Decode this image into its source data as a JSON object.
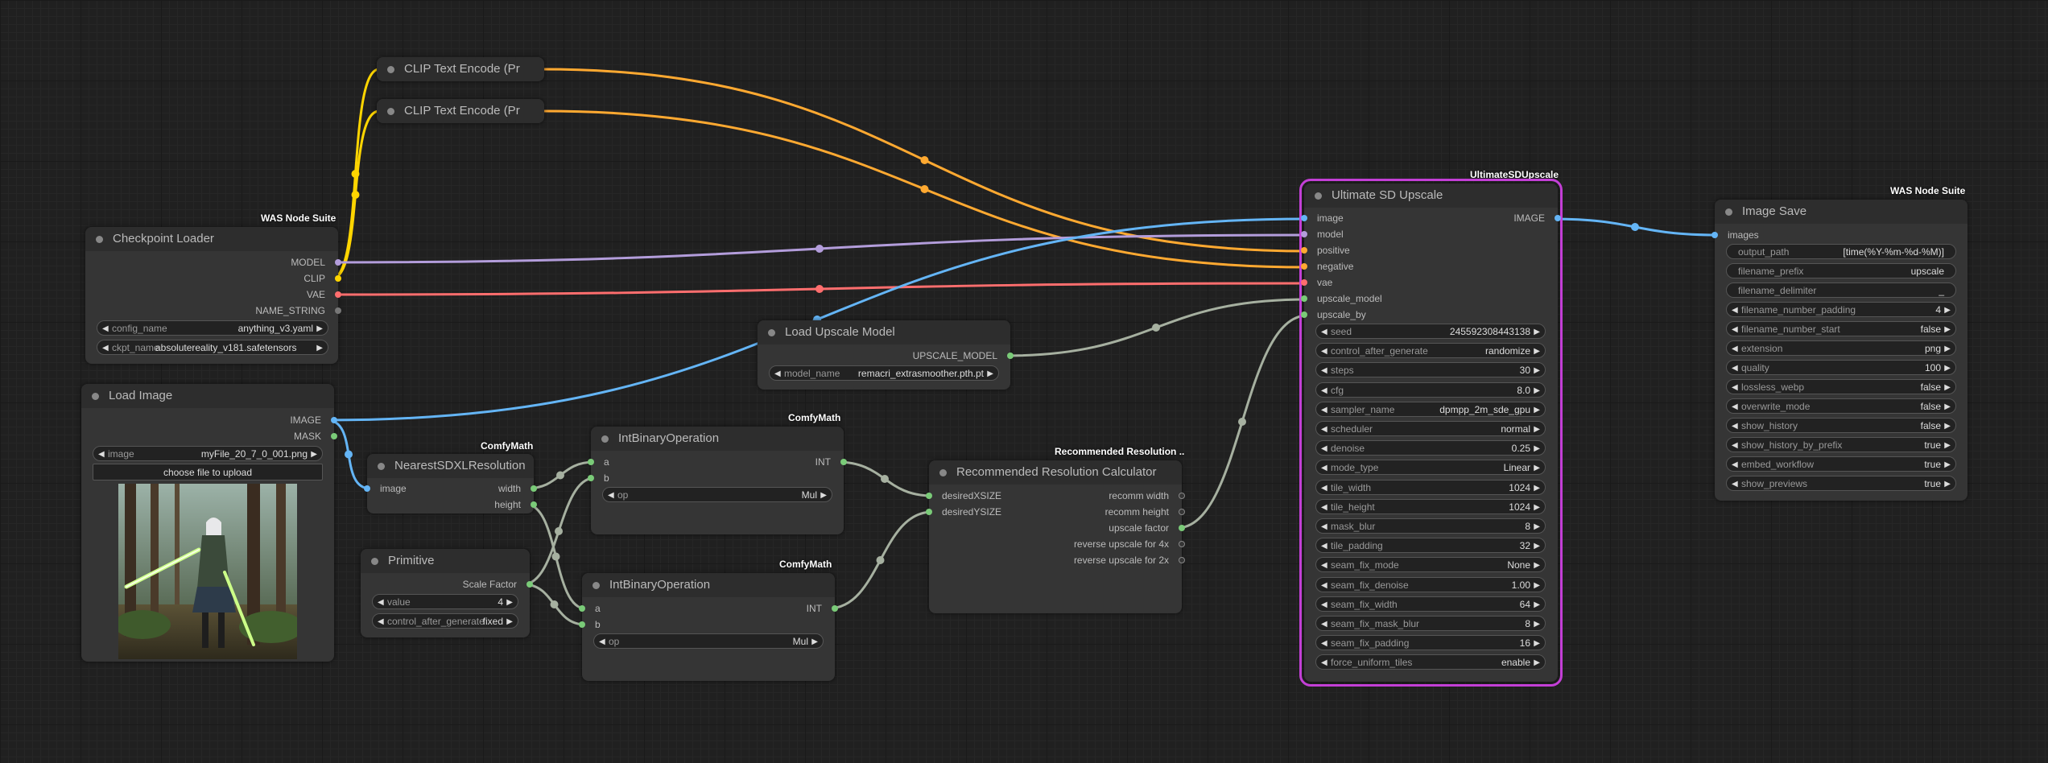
{
  "colors": {
    "model": "#b39ddb",
    "clip": "#ffd500",
    "vae": "#ff6e6e",
    "image": "#64b5f6",
    "conditioning": "#ffa931",
    "generic": "#7acb78",
    "upscale": "#a6b0a0",
    "selected": "#c33fd6"
  },
  "nodes": {
    "clip1": {
      "title": "CLIP Text Encode (Pr"
    },
    "clip2": {
      "title": "CLIP Text Encode (Pr"
    },
    "ckpt": {
      "badge": "WAS Node Suite",
      "title": "Checkpoint Loader",
      "outputs": [
        "MODEL",
        "CLIP",
        "VAE",
        "NAME_STRING"
      ],
      "config": {
        "label": "config_name",
        "value": "anything_v3.yaml"
      },
      "ckpt": {
        "label": "ckpt_name",
        "value": "absolutereality_v181.safetensors"
      }
    },
    "loadimg": {
      "title": "Load Image",
      "outputs": [
        "IMAGE",
        "MASK"
      ],
      "image": {
        "label": "image",
        "value": "myFile_20_7_0_001.png"
      },
      "upload": "choose file to upload"
    },
    "nearest": {
      "badge": "ComfyMath",
      "title": "NearestSDXLResolution",
      "inputs": [
        "image"
      ],
      "outputs": [
        "width",
        "height"
      ]
    },
    "primitive": {
      "title": "Primitive",
      "outputs": [
        "Scale Factor"
      ],
      "value": {
        "label": "value",
        "value": "4"
      },
      "cag": {
        "label": "control_after_generate",
        "value": "fixed"
      }
    },
    "ib1": {
      "badge": "ComfyMath",
      "title": "IntBinaryOperation",
      "inputs": [
        "a",
        "b"
      ],
      "outputs": [
        "INT"
      ],
      "op": {
        "label": "op",
        "value": "Mul"
      }
    },
    "ib2": {
      "badge": "ComfyMath",
      "title": "IntBinaryOperation",
      "inputs": [
        "a",
        "b"
      ],
      "outputs": [
        "INT"
      ],
      "op": {
        "label": "op",
        "value": "Mul"
      }
    },
    "upmodel": {
      "title": "Load Upscale Model",
      "outputs": [
        "UPSCALE_MODEL"
      ],
      "model": {
        "label": "model_name",
        "value": "remacri_extrasmoother.pth.pt"
      }
    },
    "recres": {
      "badge": "Recommended Resolution ..",
      "title": "Recommended Resolution Calculator",
      "inputs": [
        "desiredXSIZE",
        "desiredYSIZE"
      ],
      "outputs": [
        "recomm width",
        "recomm height",
        "upscale factor",
        "reverse upscale for 4x",
        "reverse upscale for 2x"
      ]
    },
    "usd": {
      "badge": "UltimateSDUpscale",
      "title": "Ultimate SD Upscale",
      "inputs": [
        "image",
        "model",
        "positive",
        "negative",
        "vae",
        "upscale_model",
        "upscale_by"
      ],
      "outputs": [
        "IMAGE"
      ],
      "widgets": [
        {
          "label": "seed",
          "value": "245592308443138"
        },
        {
          "label": "control_after_generate",
          "value": "randomize"
        },
        {
          "label": "steps",
          "value": "30"
        },
        {
          "label": "cfg",
          "value": "8.0"
        },
        {
          "label": "sampler_name",
          "value": "dpmpp_2m_sde_gpu"
        },
        {
          "label": "scheduler",
          "value": "normal"
        },
        {
          "label": "denoise",
          "value": "0.25"
        },
        {
          "label": "mode_type",
          "value": "Linear"
        },
        {
          "label": "tile_width",
          "value": "1024"
        },
        {
          "label": "tile_height",
          "value": "1024"
        },
        {
          "label": "mask_blur",
          "value": "8"
        },
        {
          "label": "tile_padding",
          "value": "32"
        },
        {
          "label": "seam_fix_mode",
          "value": "None"
        },
        {
          "label": "seam_fix_denoise",
          "value": "1.00"
        },
        {
          "label": "seam_fix_width",
          "value": "64"
        },
        {
          "label": "seam_fix_mask_blur",
          "value": "8"
        },
        {
          "label": "seam_fix_padding",
          "value": "16"
        },
        {
          "label": "force_uniform_tiles",
          "value": "enable"
        }
      ]
    },
    "save": {
      "badge": "WAS Node Suite",
      "title": "Image Save",
      "inputs": [
        "images"
      ],
      "texts": [
        {
          "label": "output_path",
          "value": "[time(%Y-%m-%d-%M)]"
        },
        {
          "label": "filename_prefix",
          "value": "upscale"
        },
        {
          "label": "filename_delimiter",
          "value": "_"
        }
      ],
      "widgets": [
        {
          "label": "filename_number_padding",
          "value": "4"
        },
        {
          "label": "filename_number_start",
          "value": "false"
        },
        {
          "label": "extension",
          "value": "png"
        },
        {
          "label": "quality",
          "value": "100"
        },
        {
          "label": "lossless_webp",
          "value": "false"
        },
        {
          "label": "overwrite_mode",
          "value": "false"
        },
        {
          "label": "show_history",
          "value": "false"
        },
        {
          "label": "show_history_by_prefix",
          "value": "true"
        },
        {
          "label": "embed_workflow",
          "value": "true"
        },
        {
          "label": "show_previews",
          "value": "true"
        }
      ]
    }
  }
}
